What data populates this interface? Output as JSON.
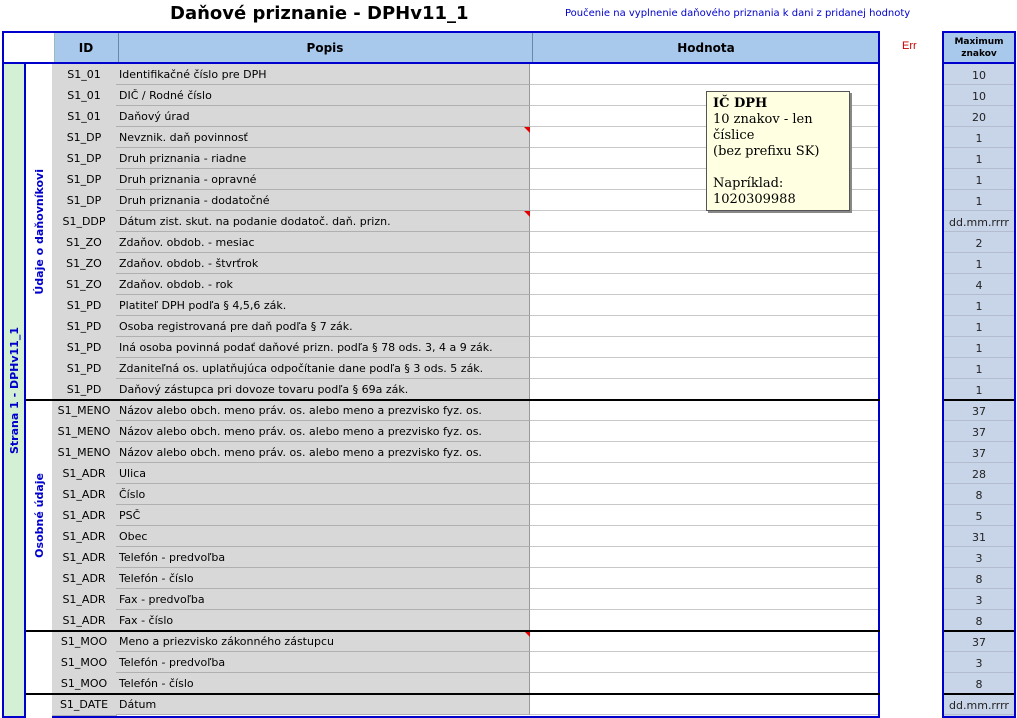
{
  "title": "Daňové priznanie - DPHv11_1",
  "instructions_link": "Poučenie na vyplnenie daňového priznania k dani z pridanej hodnoty",
  "header": {
    "id": "ID",
    "description": "Popis",
    "value": "Hodnota"
  },
  "err_label": "Err",
  "max_header": "Maximum znakov",
  "section_label": "Strana 1 - DPHv11_1",
  "groups": [
    {
      "label": "Údaje o daňovníkovi"
    },
    {
      "label": "Osobné údaje"
    }
  ],
  "rows": [
    {
      "id": "S1_01",
      "desc": "Identifikačné číslo pre DPH",
      "max": "10"
    },
    {
      "id": "S1_01",
      "desc": "DIČ / Rodné číslo",
      "max": "10"
    },
    {
      "id": "S1_01",
      "desc": "Daňový úrad",
      "max": "20"
    },
    {
      "id": "S1_DP",
      "desc": "Nevznik. daň povinnosť",
      "max": "1"
    },
    {
      "id": "S1_DP",
      "desc": "Druh priznania - riadne",
      "max": "1"
    },
    {
      "id": "S1_DP",
      "desc": "Druh priznania - opravné",
      "max": "1"
    },
    {
      "id": "S1_DP",
      "desc": "Druh priznania - dodatočné",
      "max": "1"
    },
    {
      "id": "S1_DDP",
      "desc": "Dátum zist. skut. na podanie dodatoč. daň. prizn.",
      "max": "dd.mm.rrrr"
    },
    {
      "id": "S1_ZO",
      "desc": "Zdaňov. obdob. - mesiac",
      "max": "2"
    },
    {
      "id": "S1_ZO",
      "desc": "Zdaňov. obdob. - štvrťrok",
      "max": "1"
    },
    {
      "id": "S1_ZO",
      "desc": "Zdaňov. obdob. - rok",
      "max": "4"
    },
    {
      "id": "S1_PD",
      "desc": "Platiteľ DPH podľa § 4,5,6 zák.",
      "max": "1"
    },
    {
      "id": "S1_PD",
      "desc": "Osoba registrovaná pre daň podľa § 7 zák.",
      "max": "1"
    },
    {
      "id": "S1_PD",
      "desc": "Iná osoba povinná podať daňové prizn. podľa § 78 ods. 3, 4 a 9 zák.",
      "max": "1"
    },
    {
      "id": "S1_PD",
      "desc": "Zdaniteľná os. uplatňujúca odpočítanie dane podľa § 3 ods. 5 zák.",
      "max": "1"
    },
    {
      "id": "S1_PD",
      "desc": "Daňový zástupca pri dovoze tovaru podľa § 69a zák.",
      "max": "1"
    },
    {
      "id": "S1_MENO",
      "desc": "Názov alebo obch. meno práv. os. alebo meno a prezvisko fyz. os.",
      "max": "37"
    },
    {
      "id": "S1_MENO",
      "desc": "Názov alebo obch. meno práv. os. alebo meno a prezvisko fyz. os.",
      "max": "37"
    },
    {
      "id": "S1_MENO",
      "desc": "Názov alebo obch. meno práv. os. alebo meno a prezvisko fyz. os.",
      "max": "37"
    },
    {
      "id": "S1_ADR",
      "desc": "Ulica",
      "max": "28"
    },
    {
      "id": "S1_ADR",
      "desc": "Číslo",
      "max": "8"
    },
    {
      "id": "S1_ADR",
      "desc": "PSČ",
      "max": "5"
    },
    {
      "id": "S1_ADR",
      "desc": "Obec",
      "max": "31"
    },
    {
      "id": "S1_ADR",
      "desc": "Telefón - predvoľba",
      "max": "3"
    },
    {
      "id": "S1_ADR",
      "desc": "Telefón - číslo",
      "max": "8"
    },
    {
      "id": "S1_ADR",
      "desc": "Fax - predvoľba",
      "max": "3"
    },
    {
      "id": "S1_ADR",
      "desc": "Fax - číslo",
      "max": "8"
    },
    {
      "id": "S1_MOO",
      "desc": "Meno a priezvisko zákonného zástupcu",
      "max": "37"
    },
    {
      "id": "S1_MOO",
      "desc": "Telefón - predvoľba",
      "max": "3"
    },
    {
      "id": "S1_MOO",
      "desc": "Telefón - číslo",
      "max": "8"
    },
    {
      "id": "S1_DATE",
      "desc": "Dátum",
      "max": "dd.mm.rrrr"
    }
  ],
  "tooltip": {
    "title": "IČ DPH",
    "body": "10 znakov - len číslice\n(bez prefixu SK)\n\nNapríklad:\n1020309988"
  }
}
